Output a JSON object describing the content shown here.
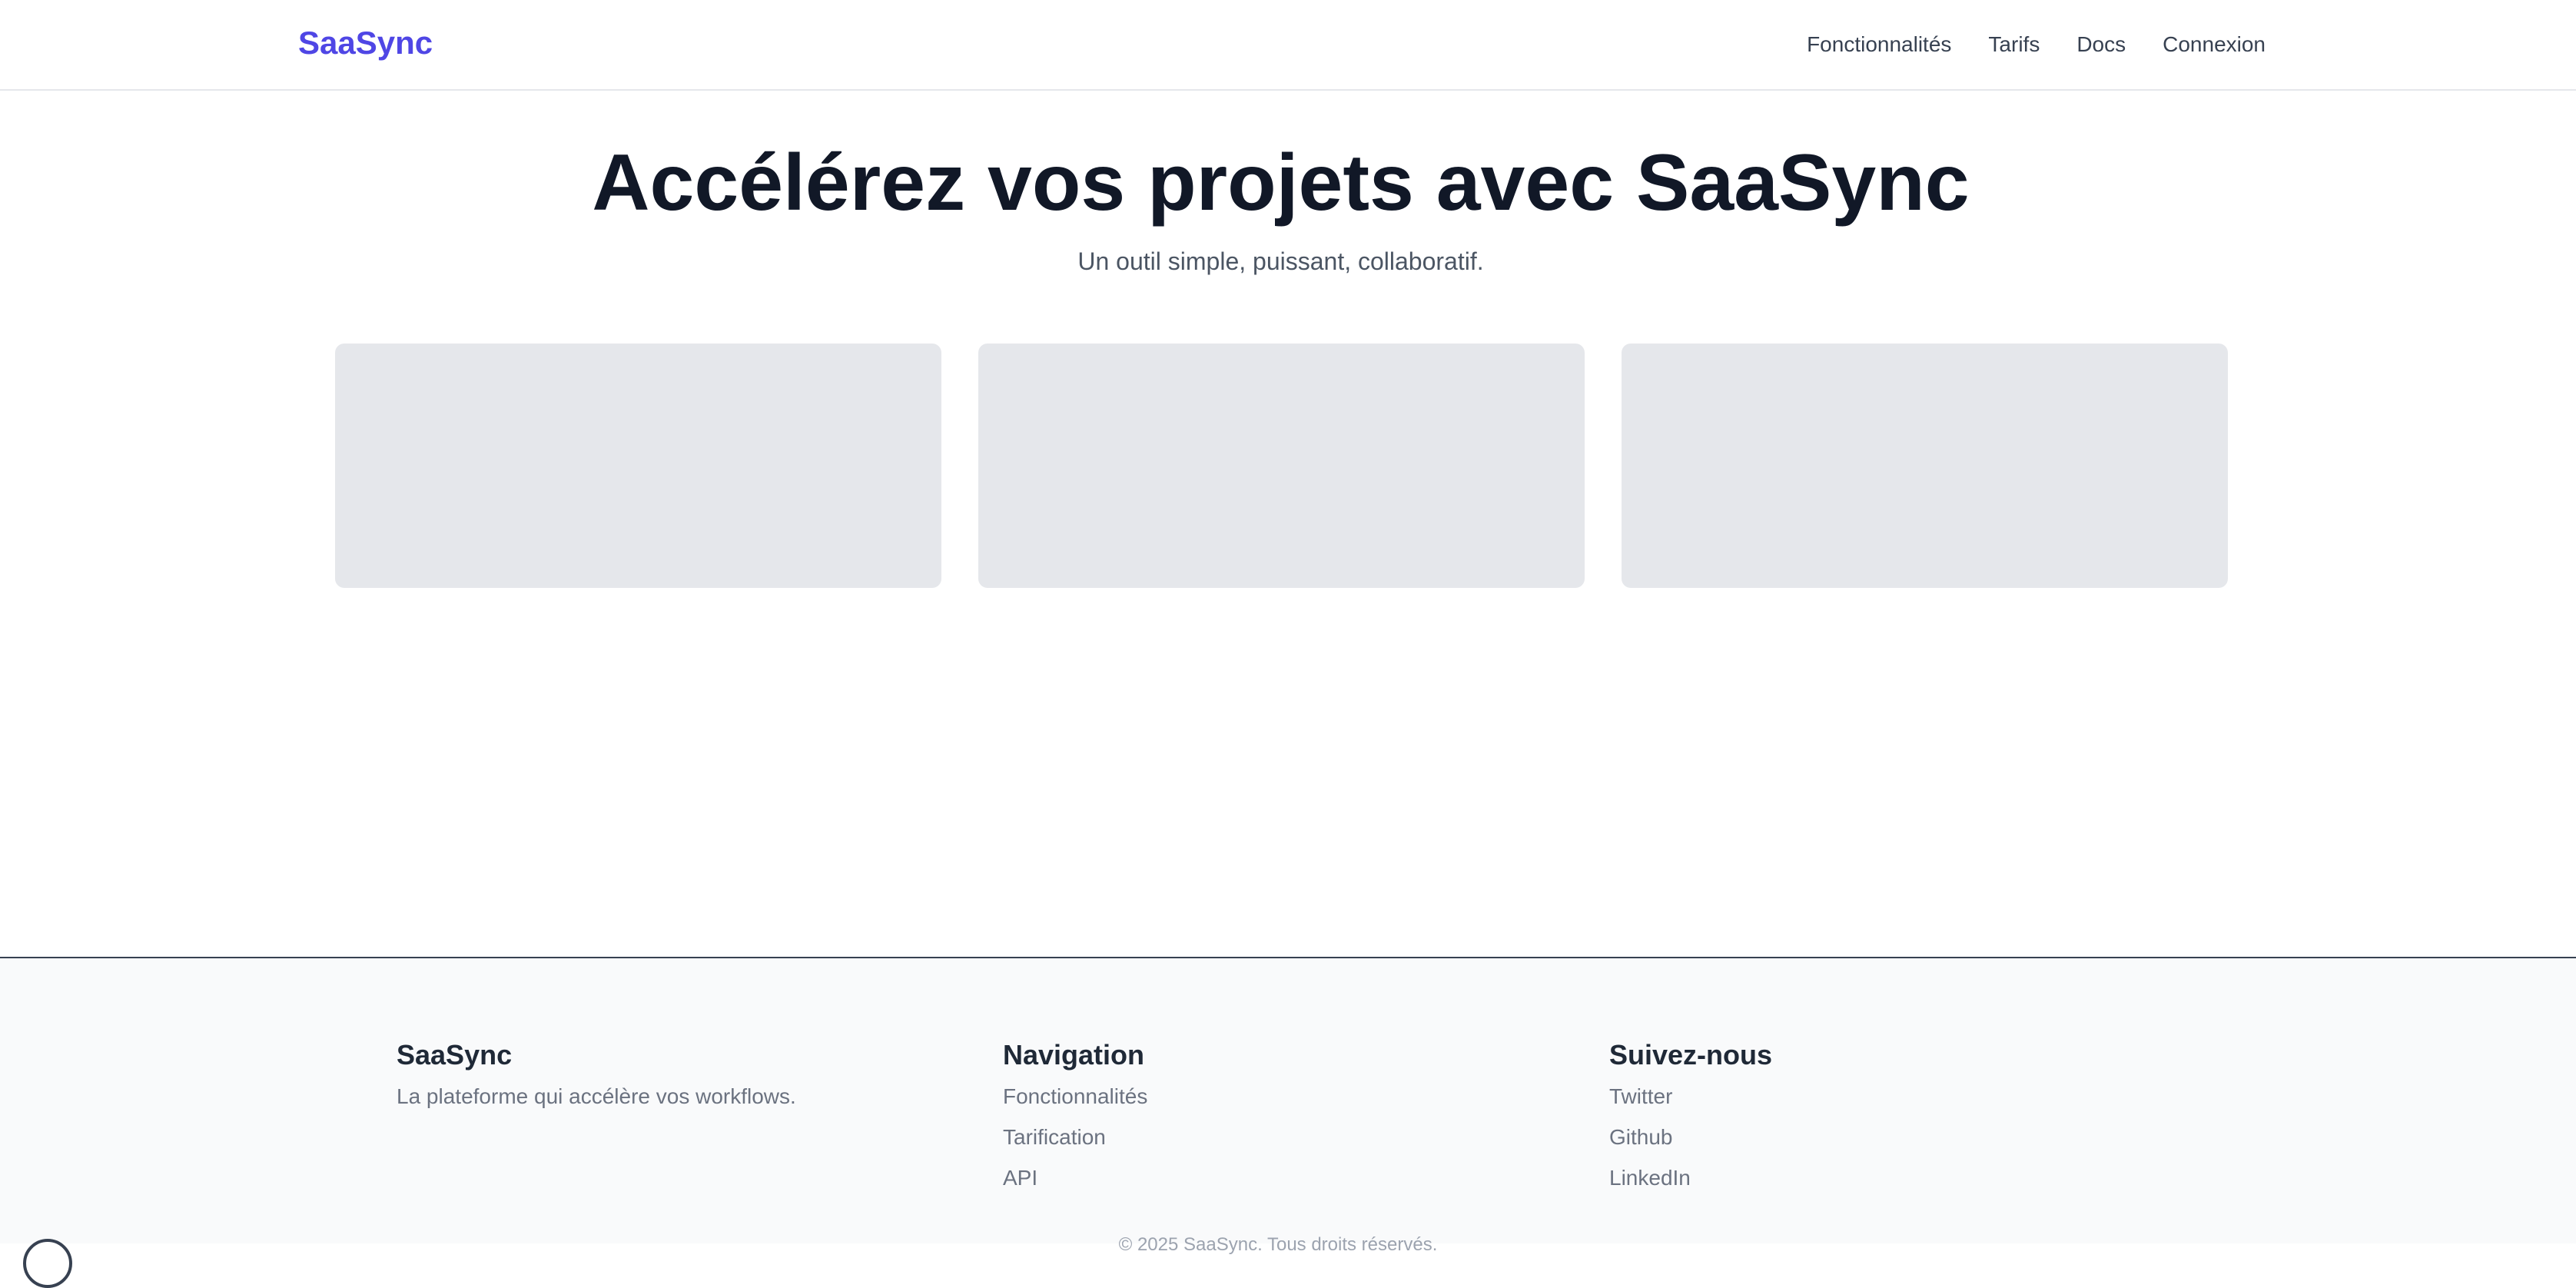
{
  "header": {
    "brand": "SaaSync",
    "nav": [
      {
        "label": "Fonctionnalités"
      },
      {
        "label": "Tarifs"
      },
      {
        "label": "Docs"
      },
      {
        "label": "Connexion"
      }
    ]
  },
  "hero": {
    "title": "Accélérez vos projets avec SaaSync",
    "subtitle": "Un outil simple, puissant, collaboratif."
  },
  "footer": {
    "about": {
      "title": "SaaSync",
      "description": "La plateforme qui accélère vos workflows."
    },
    "navigation": {
      "title": "Navigation",
      "links": [
        "Fonctionnalités",
        "Tarification",
        "API"
      ]
    },
    "social": {
      "title": "Suivez-nous",
      "links": [
        "Twitter",
        "Github",
        "LinkedIn"
      ]
    },
    "copyright": "© 2025 SaaSync. Tous droits réservés."
  },
  "colors": {
    "brand": "#4f46e5",
    "text_dark": "#111827",
    "text_muted": "#6b7280",
    "card_bg": "#e5e7eb",
    "footer_bg": "#f9fafb"
  }
}
